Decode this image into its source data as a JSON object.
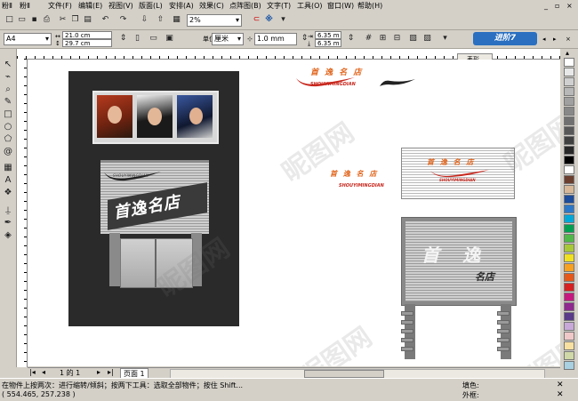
{
  "menubar": {
    "items": [
      "文件(F)",
      "编辑(E)",
      "视图(V)",
      "版面(L)",
      "安排(A)",
      "效果(C)",
      "点阵图(B)",
      "文字(T)",
      "工具(O)",
      "窗口(W)",
      "帮助(H)"
    ],
    "left_fragments": [
      "粉Ⅱ",
      "粉Ⅱ"
    ]
  },
  "toolbar1": {
    "zoom_value": "2%"
  },
  "toolbar2": {
    "paper_size": "A4",
    "width_value": "21.0 cm",
    "height_value": "29.7 cm",
    "units": "厘米",
    "nudge_value": "1.0 mm",
    "dup_x": "6.35 m",
    "dup_y": "6.35 m"
  },
  "docker": {
    "tab_label": "表形",
    "promo_label": "进阶7"
  },
  "canvas": {
    "shop_name": "首逸名店",
    "brand_latin": "SHOUYIMINGDIAN",
    "logo_chars": "首 逸 名 店",
    "sign_char_1": "首",
    "sign_char_2": "逸",
    "sign_small": "名店",
    "watermark": "昵图网"
  },
  "pagebar": {
    "page_count": "1 的 1",
    "page_tab": "页面 1"
  },
  "status": {
    "hint": "在物件上按两次：进行缩转/倾斜；按两下工具：选取全部物件；按住 Shift...",
    "coords": "( 554.465, 257.238 )",
    "fill_label": "填色:",
    "outline_label": "外框:"
  },
  "colors": {
    "chrome": "#d4d0c8",
    "dark_board": "#2a2a2a",
    "logo_orange": "#e0661e",
    "logo_red": "#c8281e"
  },
  "palette": [
    "#ffffff",
    "#e8e8e8",
    "#d0d0d0",
    "#b8b8b8",
    "#a0a0a0",
    "#888888",
    "#707070",
    "#585858",
    "#404040",
    "#282828",
    "#000000",
    "#ffffff",
    "#6c3e2e",
    "#d8b898",
    "#1c4c9c",
    "#2c78c8",
    "#00a8d8",
    "#00a050",
    "#50b848",
    "#a8c838",
    "#f0e020",
    "#f8a020",
    "#e85818",
    "#d82020",
    "#c81880",
    "#902890",
    "#5a3a8a",
    "#c8a8d8",
    "#f0c8c8",
    "#f8e0a0",
    "#d0d8a8",
    "#a8d0e0"
  ]
}
